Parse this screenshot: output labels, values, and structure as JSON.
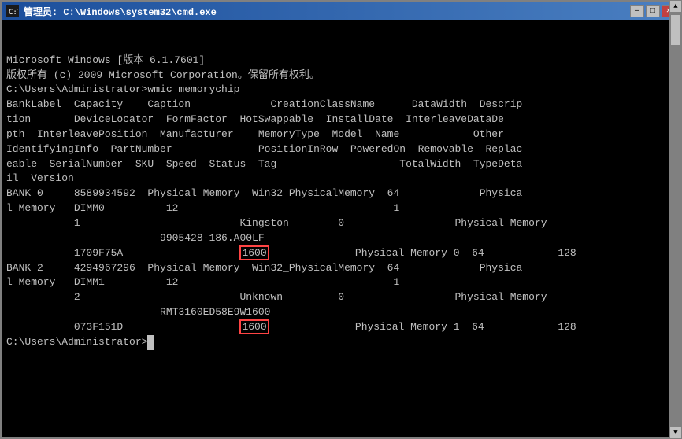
{
  "window": {
    "title": "管理员: C:\\Windows\\system32\\cmd.exe",
    "title_icon": "C:\\",
    "buttons": {
      "minimize": "—",
      "maximize": "□",
      "close": "✕"
    }
  },
  "content": {
    "lines": [
      "Microsoft Windows [版本 6.1.7601]",
      "版权所有 (c) 2009 Microsoft Corporation。保留所有权利。",
      "",
      "C:\\Users\\Administrator>wmic memorychip",
      "BankLabel  Capacity    Caption             CreationClassName      DataWidth  Descrip",
      "tion       DeviceLocator  FormFactor  HotSwappable  InstallDate  InterleaveDataDe",
      "pth  InterleavePosition  Manufacturer    MemoryType  Model  Name            Other",
      "IdentifyingInfo  PartNumber              PositionInRow  PoweredOn  Removable  Replac",
      "eable  SerialNumber  SKU  Speed  Status  Tag                    TotalWidth  TypeDeta",
      "il  Version",
      "BANK 0     8589934592  Physical Memory  Win32_PhysicalMemory  64             Physica",
      "l Memory   DIMM0          12                                   1",
      "           1                          Kingston        0                  Physical Memory",
      "                         9905428-186.A00LF",
      "           1709F75A                   1600              Physical Memory 0  64            128",
      "",
      "BANK 2     4294967296  Physical Memory  Win32_PhysicalMemory  64             Physica",
      "l Memory   DIMM1          12                                   1",
      "           2                          Unknown         0                  Physical Memory",
      "                         RMT3160ED58E9W1600",
      "           073F151D                   1600              Physical Memory 1  64            128",
      "",
      "C:\\Users\\Administrator>_"
    ],
    "highlight1_line": 14,
    "highlight1_text": "1600",
    "highlight2_line": 20,
    "highlight2_text": "1600"
  }
}
